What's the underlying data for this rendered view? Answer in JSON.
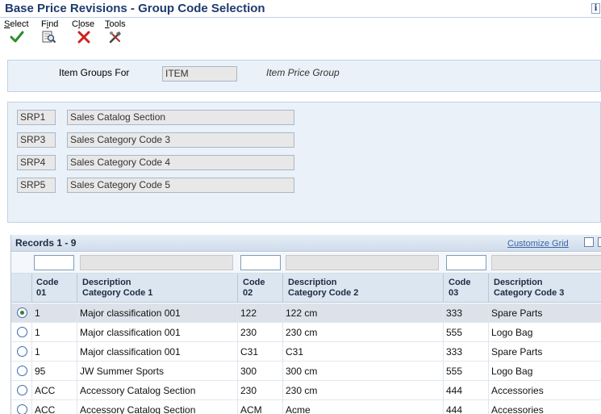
{
  "window": {
    "title": "Base Price Revisions - Group Code Selection",
    "info_icon": "i"
  },
  "toolbar": {
    "select": {
      "label_u": "S",
      "label_rest": "elect",
      "icon": "check-icon",
      "color": "#2e8b2e"
    },
    "find": {
      "label_pre": "F",
      "label_u": "i",
      "label_rest": "nd",
      "icon": "find-icon"
    },
    "close": {
      "label_pre": "C",
      "label_u": "l",
      "label_rest": "ose",
      "icon": "close-icon",
      "color": "#d0201a"
    },
    "tools": {
      "label_u": "T",
      "label_rest": "ools",
      "icon": "tools-icon"
    }
  },
  "header_panel": {
    "item_groups_label": "Item Groups For",
    "item_groups_value": "ITEM",
    "item_price_group_label": "Item Price Group"
  },
  "codes_panel": {
    "rows": [
      {
        "code": "SRP1",
        "description": "Sales Catalog Section"
      },
      {
        "code": "SRP3",
        "description": "Sales Category Code 3"
      },
      {
        "code": "SRP4",
        "description": "Sales Category Code 4"
      },
      {
        "code": "SRP5",
        "description": "Sales Category Code 5"
      }
    ]
  },
  "grid": {
    "records_label": "Records 1 - 9",
    "customize_label": "Customize Grid",
    "columns": [
      {
        "line1": "Code",
        "line2": "01"
      },
      {
        "line1": "Description",
        "line2": "Category Code 1"
      },
      {
        "line1": "Code",
        "line2": "02"
      },
      {
        "line1": "Description",
        "line2": "Category Code 2"
      },
      {
        "line1": "Code",
        "line2": "03"
      },
      {
        "line1": "Description",
        "line2": "Category Code 3"
      }
    ],
    "rows": [
      {
        "selected": true,
        "c1": "1",
        "d1": "Major classification 001",
        "c2": "122",
        "d2": "122 cm",
        "c3": "333",
        "d3": "Spare Parts"
      },
      {
        "selected": false,
        "c1": "1",
        "d1": "Major classification 001",
        "c2": "230",
        "d2": "230 cm",
        "c3": "555",
        "d3": "Logo Bag"
      },
      {
        "selected": false,
        "c1": "1",
        "d1": "Major classification 001",
        "c2": "C31",
        "d2": "C31",
        "c3": "333",
        "d3": "Spare Parts"
      },
      {
        "selected": false,
        "c1": "95",
        "d1": "JW Summer Sports",
        "c2": "300",
        "d2": "300 cm",
        "c3": "555",
        "d3": "Logo Bag"
      },
      {
        "selected": false,
        "c1": "ACC",
        "d1": "Accessory Catalog Section",
        "c2": "230",
        "d2": "230 cm",
        "c3": "444",
        "d3": "Accessories"
      },
      {
        "selected": false,
        "c1": "ACC",
        "d1": "Accessory Catalog Section",
        "c2": "ACM",
        "d2": "Acme",
        "c3": "444",
        "d3": "Accessories"
      }
    ]
  }
}
